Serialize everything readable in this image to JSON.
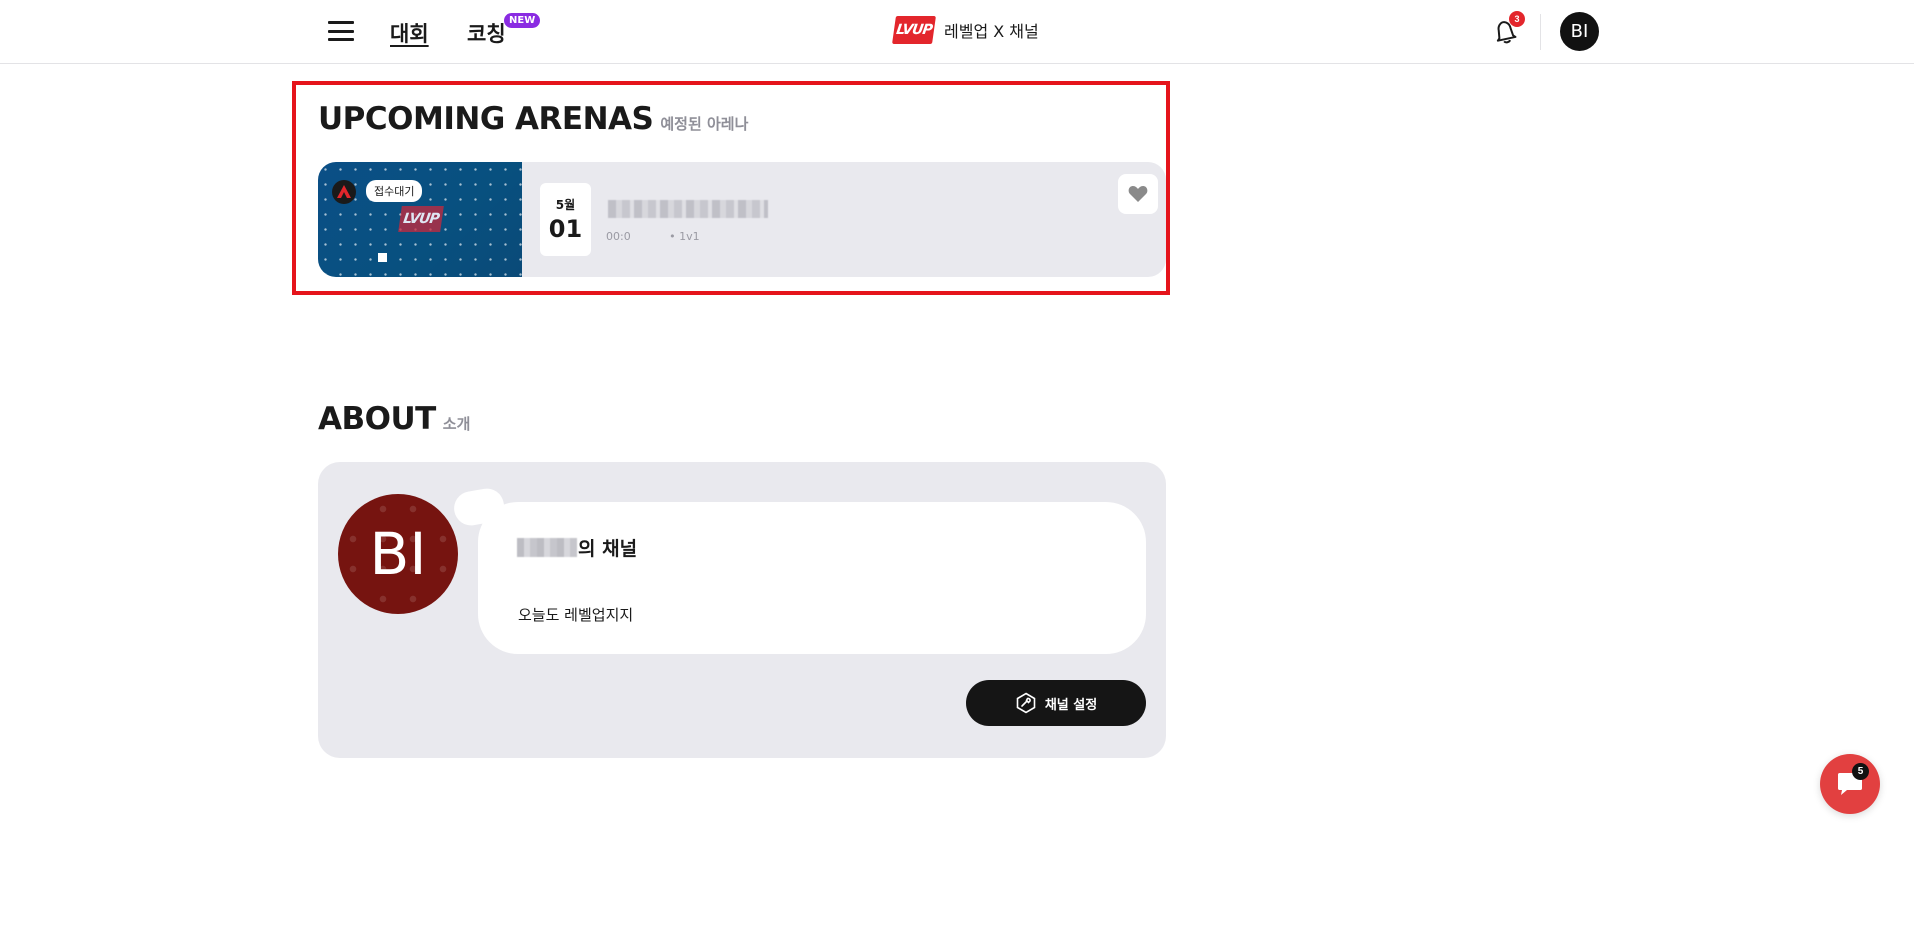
{
  "header": {
    "menu_icon": "hamburger-icon",
    "nav_tournament": "대회",
    "nav_coaching": "코칭",
    "new_badge": "NEW",
    "brand_logo": "LVUP",
    "brand_text": "레벨업 X 채널",
    "notification_count": "3",
    "avatar_initials": "BI"
  },
  "upcoming": {
    "title": "UPCOMING ARENAS",
    "subtitle": "예정된 아레나",
    "arena": {
      "status": "접수대기",
      "thumb_logo": "LVUP",
      "month": "5월",
      "day": "01",
      "meta": "00:0           • 1v1"
    }
  },
  "about": {
    "title": "ABOUT",
    "subtitle": "소개",
    "avatar_initials": "BI",
    "heading_suffix": "의 채널",
    "description": "오늘도 레벨업지지",
    "settings_button": "채널 설정"
  },
  "chat": {
    "count": "5"
  },
  "colors": {
    "accent_red": "#e5141b",
    "brand_red": "#e3262c",
    "new_purple": "#8a2be2",
    "avatar_red": "#761410",
    "card_bg": "#e9e9ee"
  }
}
